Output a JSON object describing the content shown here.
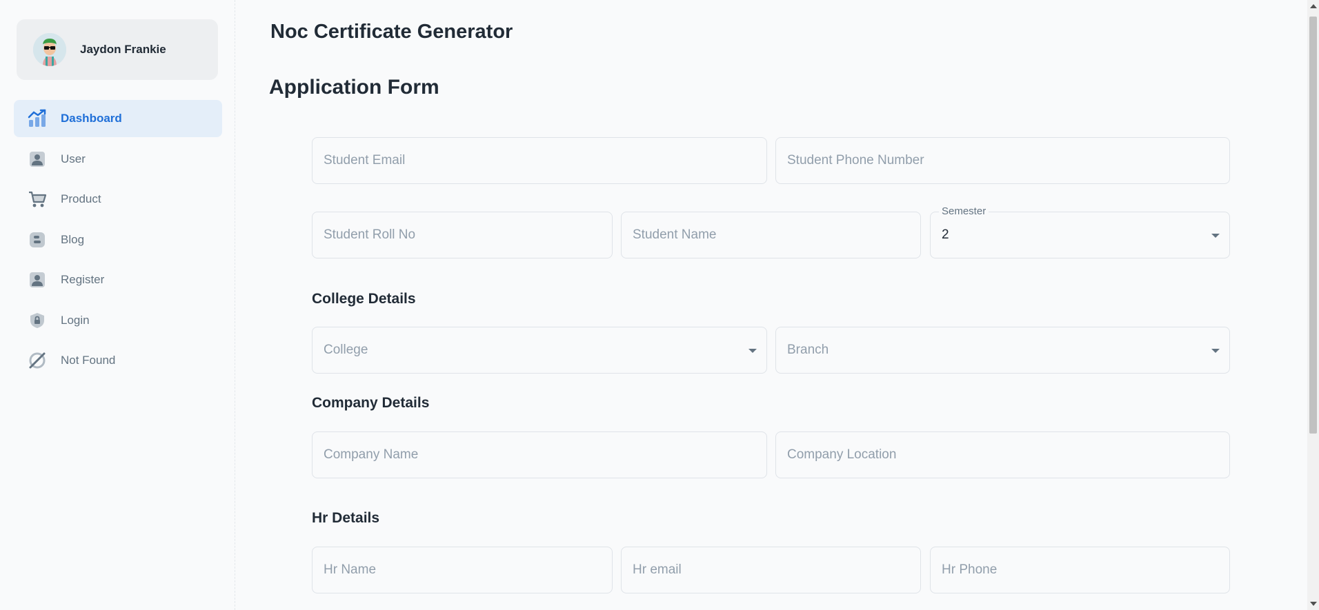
{
  "user": {
    "name": "Jaydon Frankie",
    "avatar_icon": "avatar-icon"
  },
  "nav": {
    "items": [
      {
        "label": "Dashboard",
        "icon": "analytics-icon",
        "active": true
      },
      {
        "label": "User",
        "icon": "user-icon"
      },
      {
        "label": "Product",
        "icon": "cart-icon"
      },
      {
        "label": "Blog",
        "icon": "blog-icon"
      },
      {
        "label": "Register",
        "icon": "user-icon"
      },
      {
        "label": "Login",
        "icon": "lock-icon"
      },
      {
        "label": "Not Found",
        "icon": "disabled-icon"
      }
    ]
  },
  "header": {
    "title": "Noc Certificate Generator"
  },
  "form": {
    "title": "Application Form",
    "student_email": {
      "placeholder": "Student Email"
    },
    "student_phone": {
      "placeholder": "Student Phone Number"
    },
    "student_roll": {
      "placeholder": "Student Roll No"
    },
    "student_name": {
      "placeholder": "Student Name"
    },
    "semester": {
      "label": "Semester",
      "value": "2"
    },
    "college_section": "College Details",
    "college": {
      "placeholder": "College"
    },
    "branch": {
      "placeholder": "Branch"
    },
    "company_section": "Company Details",
    "company_name": {
      "placeholder": "Company Name"
    },
    "company_location": {
      "placeholder": "Company Location"
    },
    "hr_section": "Hr Details",
    "hr_name": {
      "placeholder": "Hr Name"
    },
    "hr_email": {
      "placeholder": "Hr email"
    },
    "hr_phone": {
      "placeholder": "Hr Phone"
    }
  },
  "colors": {
    "accent": "#1f6fd8",
    "active_bg": "#e4eef9",
    "text": "#212b36",
    "muted": "#637381"
  }
}
